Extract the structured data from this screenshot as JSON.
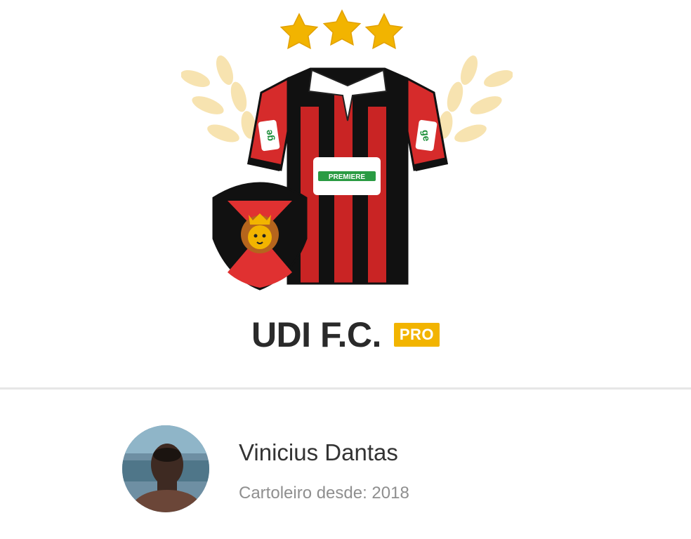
{
  "team": {
    "name": "UDI F.C.",
    "badge": "PRO",
    "stars": 3,
    "jersey_sponsor": "PREMIERE",
    "sleeve_logo": "ge",
    "icons": [
      "star-icon",
      "laurel-icon",
      "jersey-image",
      "shield-icon",
      "lion-icon"
    ]
  },
  "user": {
    "name": "Vinicius Dantas",
    "since": "Cartoleiro desde: 2018"
  },
  "colors": {
    "gold": "#f2b400",
    "red": "#e03131",
    "black": "#111111",
    "laurel": "#f7e3b0",
    "text": "#2a2a2a",
    "muted": "#8f8f8f"
  }
}
